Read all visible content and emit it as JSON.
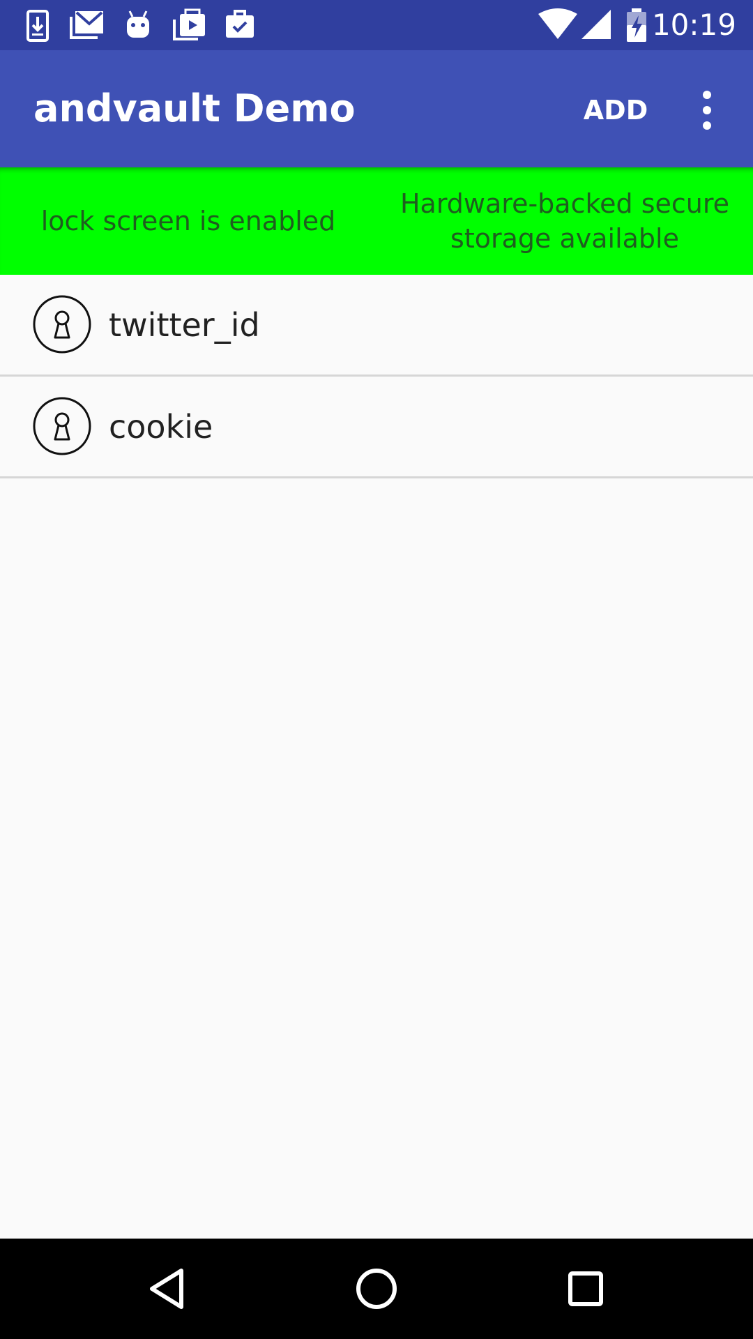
{
  "status_bar": {
    "time": "10:19",
    "notification_icons": [
      "download-icon",
      "gmail-icon",
      "android-debug-icon",
      "play-store-icon",
      "work-briefcase-icon"
    ],
    "system_icons": [
      "wifi-icon",
      "cellular-signal-icon",
      "battery-charging-icon"
    ],
    "color": "#303f9f"
  },
  "app_bar": {
    "title": "andvault Demo",
    "add_label": "ADD",
    "overflow_icon": "more-vert-icon",
    "color": "#3f51b5"
  },
  "banner": {
    "lock_screen_status": "lock screen is enabled",
    "storage_status": "Hardware-backed secure storage available",
    "color": "#00ff00"
  },
  "list": {
    "items": [
      {
        "label": "twitter_id",
        "icon": "keyhole-icon"
      },
      {
        "label": "cookie",
        "icon": "keyhole-icon"
      }
    ]
  },
  "nav_bar": {
    "buttons": [
      "back-icon",
      "home-icon",
      "recents-icon"
    ]
  }
}
